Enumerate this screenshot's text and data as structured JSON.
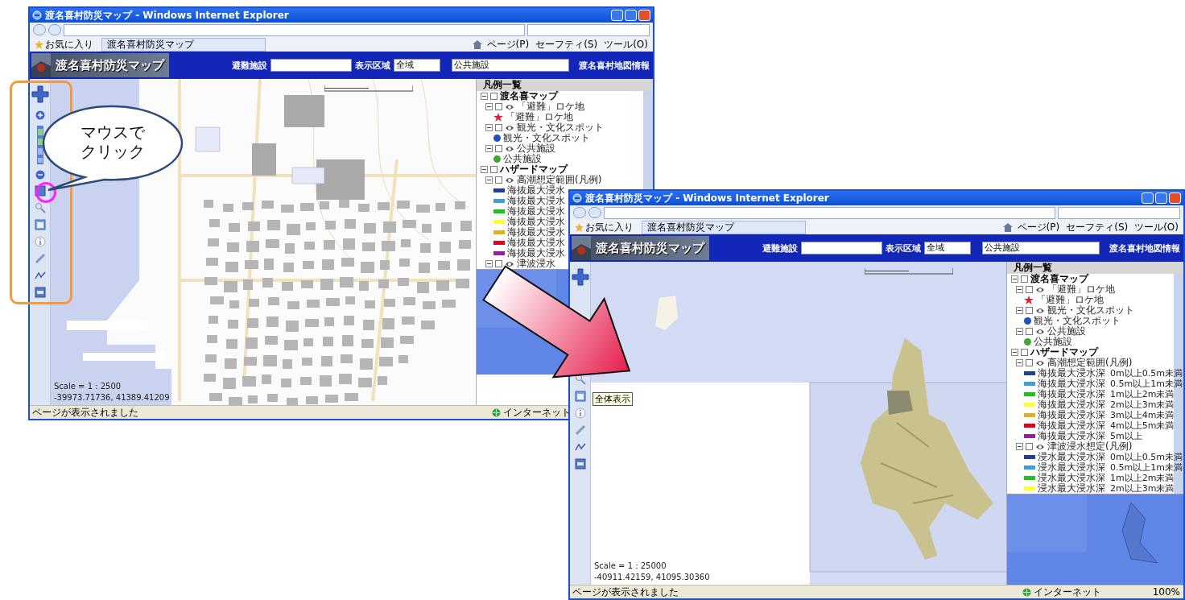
{
  "windows": [
    {
      "title": "渡名喜村防災マップ - Windows Internet Explorer",
      "favorites": "お気に入り",
      "tab": "渡名喜村防災マップ",
      "commands": [
        "ページ(P)",
        "セーフティ(S)",
        "ツール(O)"
      ],
      "site_title": "渡名喜村防災マップ",
      "controls": [
        {
          "kind": "select",
          "label": "避難施設"
        },
        {
          "kind": "select",
          "label": "表示区域",
          "value": "全域"
        },
        {
          "kind": "select",
          "value": "公共施設"
        },
        {
          "kind": "link",
          "label": "渡名喜村地図情報"
        }
      ],
      "scale": "Scale = 1 : 2500",
      "coords": "-39973.71736, 41389.41209",
      "legend": {
        "title": "凡例一覧",
        "items": [
          {
            "kind": "group",
            "label": "渡名喜マップ",
            "expanded": true,
            "checked": false,
            "children": [
              {
                "kind": "layer",
                "label": "「避難」ロケ地",
                "expanded": true,
                "checked": false,
                "children": [
                  {
                    "kind": "star",
                    "label": "「避難」ロケ地",
                    "color": "#e02030"
                  }
                ]
              },
              {
                "kind": "layer",
                "label": "観光・文化スポット",
                "expanded": true,
                "checked": false,
                "children": [
                  {
                    "kind": "dot",
                    "label": "観光・文化スポット",
                    "color": "#2050c0"
                  }
                ]
              },
              {
                "kind": "layer",
                "label": "公共施設",
                "expanded": true,
                "checked": false,
                "children": [
                  {
                    "kind": "dot",
                    "label": "公共施設",
                    "color": "#40a830"
                  }
                ]
              }
            ]
          },
          {
            "kind": "group",
            "label": "ハザードマップ",
            "expanded": true,
            "checked": false,
            "children": [
              {
                "kind": "layer",
                "label": "高潮想定範囲(凡例)",
                "expanded": true,
                "checked": false,
                "children": [
                  {
                    "kind": "swatch",
                    "label": "海抜最大浸水",
                    "color": "#1f3f9f"
                  },
                  {
                    "kind": "swatch",
                    "label": "海抜最大浸水",
                    "color": "#3fa0d0"
                  },
                  {
                    "kind": "swatch",
                    "label": "海抜最大浸水",
                    "color": "#20c020"
                  },
                  {
                    "kind": "swatch",
                    "label": "海抜最大浸水",
                    "color": "#ffff30"
                  },
                  {
                    "kind": "swatch",
                    "label": "海抜最大浸水",
                    "color": "#e0b020"
                  },
                  {
                    "kind": "swatch",
                    "label": "海抜最大浸水",
                    "color": "#e00020"
                  },
                  {
                    "kind": "swatch",
                    "label": "海抜最大浸水",
                    "color": "#9020a0"
                  }
                ]
              },
              {
                "kind": "layer",
                "label": "津波浸水",
                "expanded": true,
                "checked": false
              }
            ]
          }
        ]
      },
      "status": "ページが表示されました",
      "zone": "インターネット"
    },
    {
      "title": "渡名喜村防災マップ - Windows Internet Explorer",
      "favorites": "お気に入り",
      "tab": "渡名喜村防災マップ",
      "commands": [
        "ページ(P)",
        "セーフティ(S)",
        "ツール(O)"
      ],
      "site_title": "渡名喜村防災マップ",
      "controls": [
        {
          "kind": "select",
          "label": "避難施設"
        },
        {
          "kind": "select",
          "label": "表示区域",
          "value": "全域"
        },
        {
          "kind": "select",
          "value": "公共施設"
        },
        {
          "kind": "link",
          "label": "渡名喜村地図情報"
        }
      ],
      "scale": "Scale = 1 : 25000",
      "coords": "-40911.42159, 41095.30360",
      "tooltip": "全体表示",
      "legend": {
        "title": "凡例一覧",
        "items": [
          {
            "kind": "group",
            "label": "渡名喜マップ",
            "expanded": true,
            "checked": false,
            "children": [
              {
                "kind": "layer",
                "label": "「避難」ロケ地",
                "expanded": true,
                "checked": false,
                "children": [
                  {
                    "kind": "star",
                    "label": "「避難」ロケ地",
                    "color": "#e02030"
                  }
                ]
              },
              {
                "kind": "layer",
                "label": "観光・文化スポット",
                "expanded": true,
                "checked": false,
                "children": [
                  {
                    "kind": "dot",
                    "label": "観光・文化スポット",
                    "color": "#2050c0"
                  }
                ]
              },
              {
                "kind": "layer",
                "label": "公共施設",
                "expanded": true,
                "checked": false,
                "children": [
                  {
                    "kind": "dot",
                    "label": "公共施設",
                    "color": "#40a830"
                  }
                ]
              }
            ]
          },
          {
            "kind": "group",
            "label": "ハザードマップ",
            "expanded": true,
            "checked": false,
            "children": [
              {
                "kind": "layer",
                "label": "高潮想定範囲(凡例)",
                "expanded": true,
                "checked": false,
                "children": [
                  {
                    "kind": "swatch",
                    "label": "海抜最大浸水深",
                    "note": "0m以上0.5m未満",
                    "color": "#1f3f9f"
                  },
                  {
                    "kind": "swatch",
                    "label": "海抜最大浸水深",
                    "note": "0.5m以上1m未満",
                    "color": "#3fa0d0"
                  },
                  {
                    "kind": "swatch",
                    "label": "海抜最大浸水深",
                    "note": "1m以上2m未満",
                    "color": "#20c020"
                  },
                  {
                    "kind": "swatch",
                    "label": "海抜最大浸水深",
                    "note": "2m以上3m未満",
                    "color": "#ffff30"
                  },
                  {
                    "kind": "swatch",
                    "label": "海抜最大浸水深",
                    "note": "3m以上4m未満",
                    "color": "#e0b020"
                  },
                  {
                    "kind": "swatch",
                    "label": "海抜最大浸水深",
                    "note": "4m以上5m未満",
                    "color": "#e00020"
                  },
                  {
                    "kind": "swatch",
                    "label": "海抜最大浸水深",
                    "note": "5m以上",
                    "color": "#9020a0"
                  }
                ]
              },
              {
                "kind": "layer",
                "label": "津波浸水想定(凡例)",
                "expanded": true,
                "checked": false,
                "children": [
                  {
                    "kind": "swatch",
                    "label": "浸水最大浸水深",
                    "note": "0m以上0.5m未満",
                    "color": "#1f3f9f"
                  },
                  {
                    "kind": "swatch",
                    "label": "浸水最大浸水深",
                    "note": "0.5m以上1m未満",
                    "color": "#3fa0d0"
                  },
                  {
                    "kind": "swatch",
                    "label": "浸水最大浸水深",
                    "note": "1m以上2m未満",
                    "color": "#20c020"
                  },
                  {
                    "kind": "swatch",
                    "label": "浸水最大浸水深",
                    "note": "2m以上3m未満",
                    "color": "#ffff30"
                  }
                ]
              }
            ]
          }
        ]
      },
      "status": "ページが表示されました",
      "zone": "インターネット",
      "zoom": "100%"
    }
  ],
  "callout": {
    "text": "マウスでクリック"
  }
}
